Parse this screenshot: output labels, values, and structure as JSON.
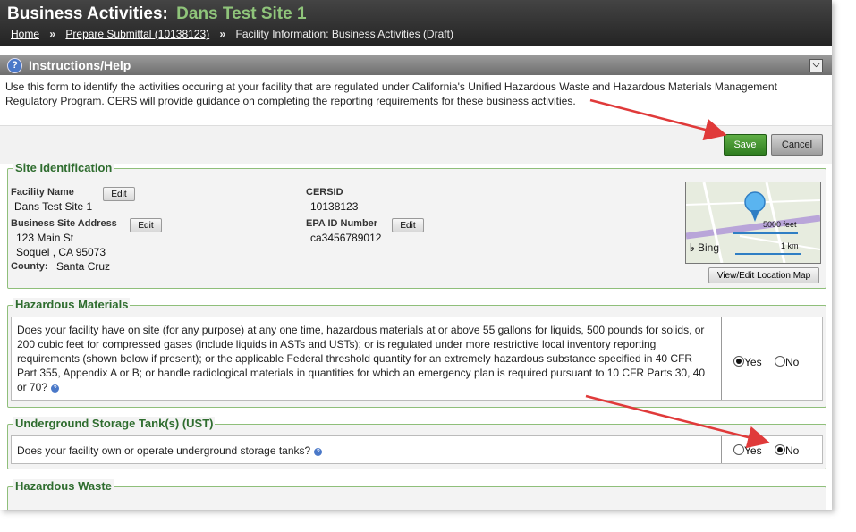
{
  "header": {
    "title_prefix": "Business Activities:",
    "site_name": "Dans Test Site 1",
    "breadcrumb": {
      "home": "Home",
      "sep": "»",
      "submittal": "Prepare Submittal (10138123)",
      "current": "Facility Information: Business Activities (Draft)"
    }
  },
  "instructions": {
    "title": "Instructions/Help",
    "text": "Use this form to identify the activities occuring at your facility that are regulated under California's Unified Hazardous Waste and Hazardous Materials Management Regulatory Program. CERS will provide guidance on completing the reporting requirements for these business activities."
  },
  "actions": {
    "save": "Save",
    "cancel": "Cancel"
  },
  "site": {
    "legend": "Site Identification",
    "facility_name_label": "Facility Name",
    "facility_name": "Dans Test Site 1",
    "address_label": "Business Site Address",
    "address_line1": "123 Main St",
    "address_line2": "Soquel , CA  95073",
    "county_label": "County:",
    "county": "Santa Cruz",
    "cersid_label": "CERSID",
    "cersid": "10138123",
    "epa_label": "EPA ID Number",
    "epa": "ca3456789012",
    "edit": "Edit",
    "map_btn": "View/Edit Location Map",
    "map_scale_ft": "5000 feet",
    "map_scale_km": "1 km",
    "map_brand": "Bing"
  },
  "hazmat": {
    "legend": "Hazardous Materials",
    "question": "Does your facility have on site (for any purpose) at any one time, hazardous materials at or above 55 gallons for liquids, 500 pounds for solids, or 200 cubic feet for compressed gases (include liquids in ASTs and USTs); or is regulated under more restrictive local inventory reporting requirements (shown below if present); or the applicable Federal threshold quantity for an extremely hazardous substance specified in 40 CFR Part 355, Appendix A or B; or handle radiological materials in quantities for which an emergency plan is required pursuant to 10 CFR Parts 30, 40 or 70?",
    "yes": "Yes",
    "no": "No",
    "selected": "Yes"
  },
  "ust": {
    "legend": "Underground Storage Tank(s) (UST)",
    "question": "Does your facility own or operate underground storage tanks?",
    "yes": "Yes",
    "no": "No",
    "selected": "No"
  },
  "hazwaste": {
    "legend": "Hazardous Waste"
  },
  "colors": {
    "accent_green": "#2f7d1f",
    "annotation_red": "#e03a3a",
    "legend_green": "#2f6d2f"
  }
}
